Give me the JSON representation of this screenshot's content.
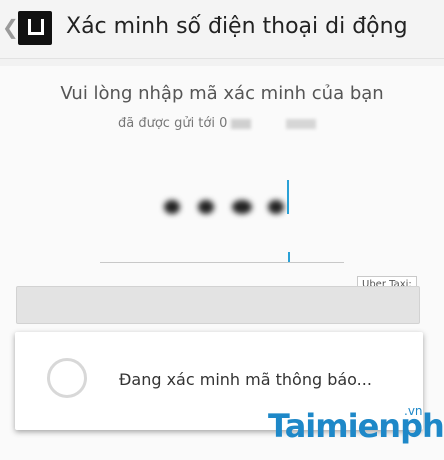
{
  "header": {
    "title": "Xác minh số điện thoại di động"
  },
  "form": {
    "prompt": "Vui lòng nhập mã xác minh của bạn",
    "sent_to": "đã được gửi tới 0"
  },
  "tooltip": {
    "text": "Uber Taxi:"
  },
  "dialog": {
    "message": "Đang xác minh mã thông báo..."
  },
  "watermark": {
    "brand": "Taimienphi",
    "tld": ".vn"
  }
}
